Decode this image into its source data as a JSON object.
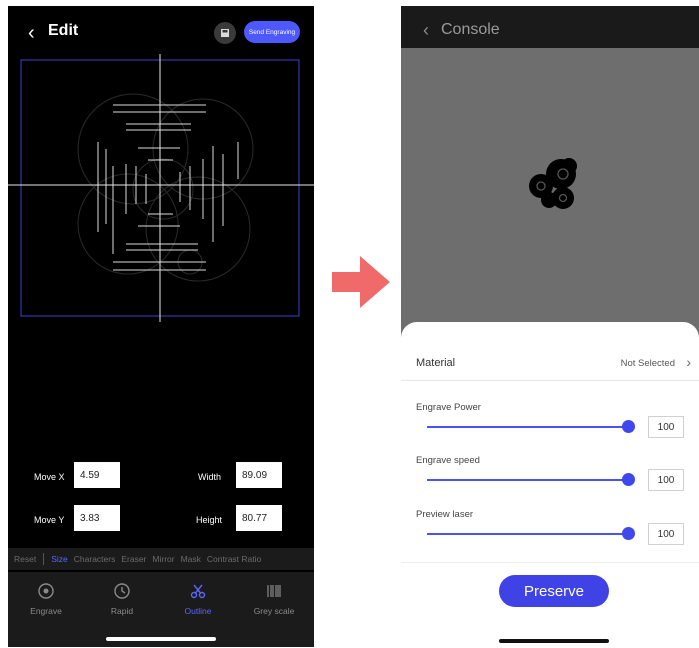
{
  "left": {
    "title": "Edit",
    "send_button": "Send Engraving",
    "fields": {
      "move_x_label": "Move X",
      "move_x_value": "4.59",
      "move_y_label": "Move Y",
      "move_y_value": "3.83",
      "width_label": "Width",
      "width_value": "89.09",
      "height_label": "Height",
      "height_value": "80.77"
    },
    "toolbar": [
      "Reset",
      "Size",
      "Characters",
      "Eraser",
      "Mirror",
      "Mask",
      "Contrast Ratio"
    ],
    "toolbar_active": "Size",
    "nav": [
      {
        "label": "Engrave",
        "icon": "engrave-icon"
      },
      {
        "label": "Rapid",
        "icon": "rapid-clock-icon"
      },
      {
        "label": "Outline",
        "icon": "outline-scissors-icon"
      },
      {
        "label": "Grey scale",
        "icon": "grey-scale-icon"
      }
    ],
    "nav_active": "Outline"
  },
  "right": {
    "title": "Console",
    "material_label": "Material",
    "material_value": "Not Selected",
    "sliders": [
      {
        "label": "Engrave Power",
        "value": "100"
      },
      {
        "label": "Engrave speed",
        "value": "100"
      },
      {
        "label": "Preview laser",
        "value": "100"
      }
    ],
    "preserve_button": "Preserve"
  },
  "colors": {
    "accent": "#4d58ff",
    "arrow": "#f06a6a",
    "dark_bg": "#000000",
    "sheet_bg": "#ffffff",
    "preview_bg": "#6e6e6e"
  }
}
